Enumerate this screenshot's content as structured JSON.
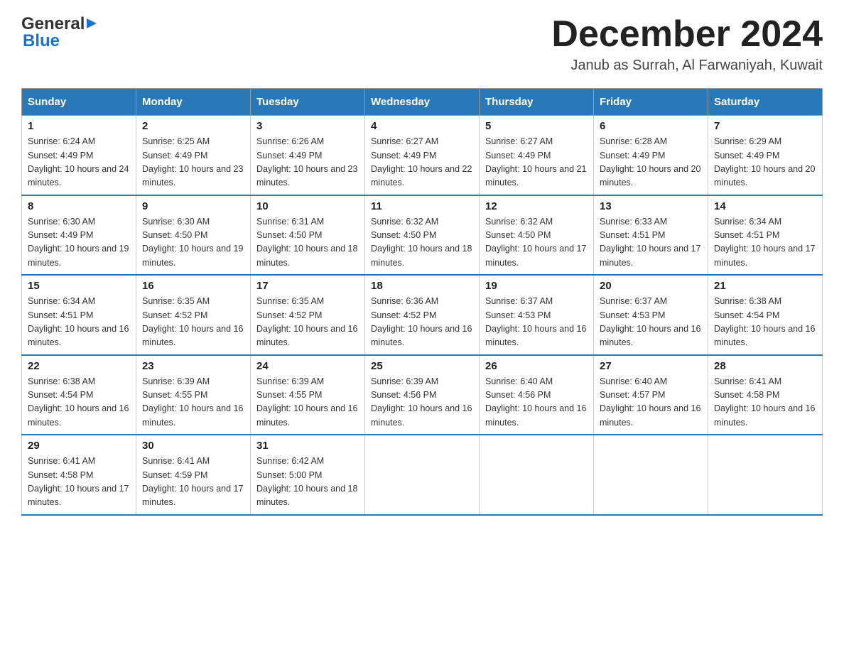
{
  "header": {
    "logo_general": "General",
    "logo_blue": "Blue",
    "month_title": "December 2024",
    "location": "Janub as Surrah, Al Farwaniyah, Kuwait"
  },
  "weekdays": [
    "Sunday",
    "Monday",
    "Tuesday",
    "Wednesday",
    "Thursday",
    "Friday",
    "Saturday"
  ],
  "weeks": [
    [
      {
        "day": "1",
        "sunrise": "6:24 AM",
        "sunset": "4:49 PM",
        "daylight": "10 hours and 24 minutes."
      },
      {
        "day": "2",
        "sunrise": "6:25 AM",
        "sunset": "4:49 PM",
        "daylight": "10 hours and 23 minutes."
      },
      {
        "day": "3",
        "sunrise": "6:26 AM",
        "sunset": "4:49 PM",
        "daylight": "10 hours and 23 minutes."
      },
      {
        "day": "4",
        "sunrise": "6:27 AM",
        "sunset": "4:49 PM",
        "daylight": "10 hours and 22 minutes."
      },
      {
        "day": "5",
        "sunrise": "6:27 AM",
        "sunset": "4:49 PM",
        "daylight": "10 hours and 21 minutes."
      },
      {
        "day": "6",
        "sunrise": "6:28 AM",
        "sunset": "4:49 PM",
        "daylight": "10 hours and 20 minutes."
      },
      {
        "day": "7",
        "sunrise": "6:29 AM",
        "sunset": "4:49 PM",
        "daylight": "10 hours and 20 minutes."
      }
    ],
    [
      {
        "day": "8",
        "sunrise": "6:30 AM",
        "sunset": "4:49 PM",
        "daylight": "10 hours and 19 minutes."
      },
      {
        "day": "9",
        "sunrise": "6:30 AM",
        "sunset": "4:50 PM",
        "daylight": "10 hours and 19 minutes."
      },
      {
        "day": "10",
        "sunrise": "6:31 AM",
        "sunset": "4:50 PM",
        "daylight": "10 hours and 18 minutes."
      },
      {
        "day": "11",
        "sunrise": "6:32 AM",
        "sunset": "4:50 PM",
        "daylight": "10 hours and 18 minutes."
      },
      {
        "day": "12",
        "sunrise": "6:32 AM",
        "sunset": "4:50 PM",
        "daylight": "10 hours and 17 minutes."
      },
      {
        "day": "13",
        "sunrise": "6:33 AM",
        "sunset": "4:51 PM",
        "daylight": "10 hours and 17 minutes."
      },
      {
        "day": "14",
        "sunrise": "6:34 AM",
        "sunset": "4:51 PM",
        "daylight": "10 hours and 17 minutes."
      }
    ],
    [
      {
        "day": "15",
        "sunrise": "6:34 AM",
        "sunset": "4:51 PM",
        "daylight": "10 hours and 16 minutes."
      },
      {
        "day": "16",
        "sunrise": "6:35 AM",
        "sunset": "4:52 PM",
        "daylight": "10 hours and 16 minutes."
      },
      {
        "day": "17",
        "sunrise": "6:35 AM",
        "sunset": "4:52 PM",
        "daylight": "10 hours and 16 minutes."
      },
      {
        "day": "18",
        "sunrise": "6:36 AM",
        "sunset": "4:52 PM",
        "daylight": "10 hours and 16 minutes."
      },
      {
        "day": "19",
        "sunrise": "6:37 AM",
        "sunset": "4:53 PM",
        "daylight": "10 hours and 16 minutes."
      },
      {
        "day": "20",
        "sunrise": "6:37 AM",
        "sunset": "4:53 PM",
        "daylight": "10 hours and 16 minutes."
      },
      {
        "day": "21",
        "sunrise": "6:38 AM",
        "sunset": "4:54 PM",
        "daylight": "10 hours and 16 minutes."
      }
    ],
    [
      {
        "day": "22",
        "sunrise": "6:38 AM",
        "sunset": "4:54 PM",
        "daylight": "10 hours and 16 minutes."
      },
      {
        "day": "23",
        "sunrise": "6:39 AM",
        "sunset": "4:55 PM",
        "daylight": "10 hours and 16 minutes."
      },
      {
        "day": "24",
        "sunrise": "6:39 AM",
        "sunset": "4:55 PM",
        "daylight": "10 hours and 16 minutes."
      },
      {
        "day": "25",
        "sunrise": "6:39 AM",
        "sunset": "4:56 PM",
        "daylight": "10 hours and 16 minutes."
      },
      {
        "day": "26",
        "sunrise": "6:40 AM",
        "sunset": "4:56 PM",
        "daylight": "10 hours and 16 minutes."
      },
      {
        "day": "27",
        "sunrise": "6:40 AM",
        "sunset": "4:57 PM",
        "daylight": "10 hours and 16 minutes."
      },
      {
        "day": "28",
        "sunrise": "6:41 AM",
        "sunset": "4:58 PM",
        "daylight": "10 hours and 16 minutes."
      }
    ],
    [
      {
        "day": "29",
        "sunrise": "6:41 AM",
        "sunset": "4:58 PM",
        "daylight": "10 hours and 17 minutes."
      },
      {
        "day": "30",
        "sunrise": "6:41 AM",
        "sunset": "4:59 PM",
        "daylight": "10 hours and 17 minutes."
      },
      {
        "day": "31",
        "sunrise": "6:42 AM",
        "sunset": "5:00 PM",
        "daylight": "10 hours and 18 minutes."
      },
      null,
      null,
      null,
      null
    ]
  ]
}
